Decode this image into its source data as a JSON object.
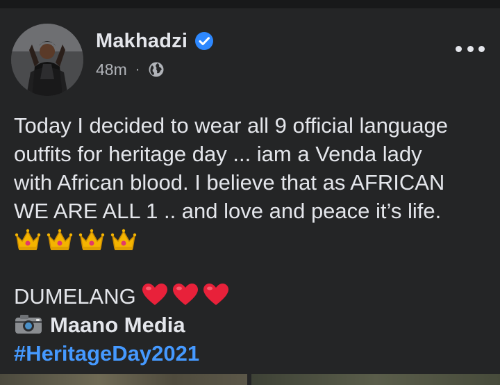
{
  "post": {
    "author": "Makhadzi",
    "timestamp": "48m",
    "separator": "·",
    "privacy_icon": "globe-icon",
    "verified_icon": "verified-badge-icon",
    "more_icon": "more-options-icon",
    "text": {
      "line1": "Today I decided to wear all 9 official language",
      "line2": "outfits for heritage day ... iam a Venda lady",
      "line3": "with African blood. I believe that as AFRICAN",
      "line4": "WE ARE ALL 1 .. and love and peace it’s life.",
      "crowns": [
        "crown-emoji",
        "crown-emoji",
        "crown-emoji",
        "crown-emoji"
      ],
      "greeting": "DUMELANG",
      "hearts": [
        "heart-emoji",
        "heart-emoji",
        "heart-emoji"
      ],
      "credit_icon": "camera-emoji",
      "credit": "Maano Media",
      "hashtag": "#HeritageDay2021"
    }
  },
  "colors": {
    "background": "#242526",
    "text": "#e4e6eb",
    "secondary_text": "#b0b3b8",
    "link": "#4599ff",
    "verified": "#2d88ff"
  }
}
